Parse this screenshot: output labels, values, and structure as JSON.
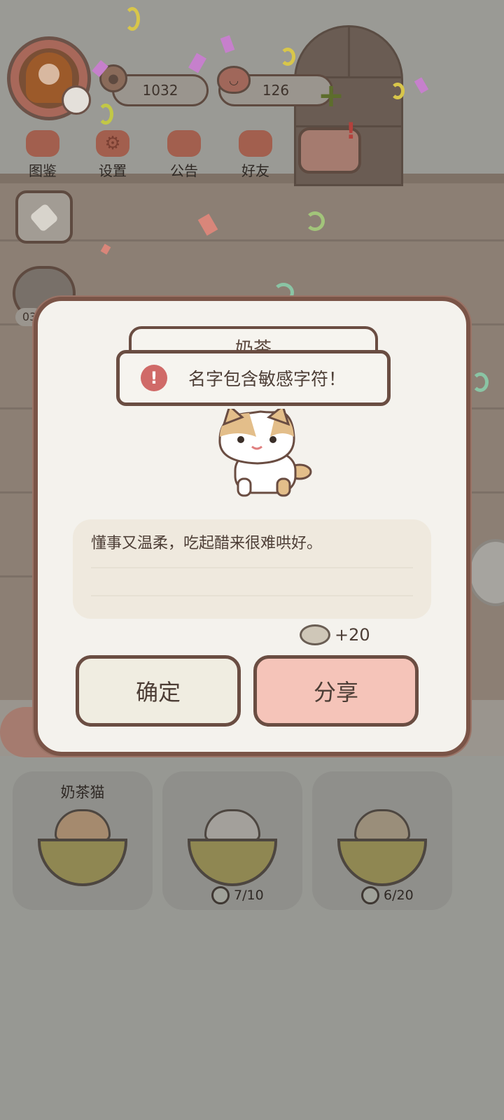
{
  "hud": {
    "coins": "1032",
    "hearts": "126"
  },
  "menu": [
    {
      "label": "图鉴",
      "icon": "cat-face-icon"
    },
    {
      "label": "设置",
      "icon": "gear-icon"
    },
    {
      "label": "公告",
      "icon": "gift-icon"
    },
    {
      "label": "好友",
      "icon": "friends-icon"
    }
  ],
  "side": {
    "mouse_count": "03"
  },
  "dialog": {
    "cat_name": "奶茶",
    "toast": "名字包含敏感字符！",
    "description": "懂事又温柔，吃起醋来很难哄好。",
    "reward": "+20",
    "confirm_label": "确定",
    "share_label": "分享"
  },
  "cards": [
    {
      "name": "奶茶猫",
      "progress": ""
    },
    {
      "name": "",
      "progress": "7/10"
    },
    {
      "name": "",
      "progress": "6/20"
    }
  ],
  "colors": {
    "dialog_border": "#7a5447",
    "share_button": "#f5c4b9",
    "confirm_button": "#f0ede1",
    "toast_icon": "#d06a68"
  }
}
